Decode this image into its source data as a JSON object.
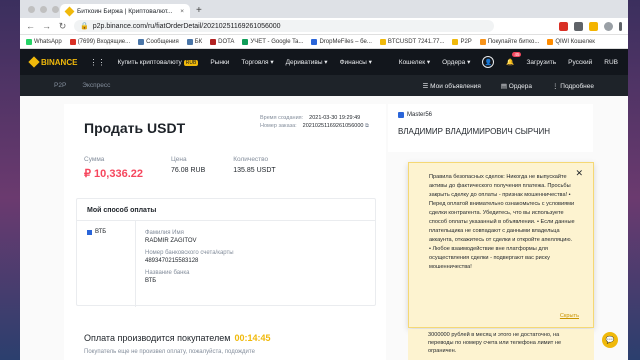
{
  "browser": {
    "tab_title": "Биткоин Биржа | Криптовалют...",
    "tab_close": "×",
    "new_tab": "+",
    "url": "p2p.binance.com/ru/fiatOrderDetail/20210251169261056000"
  },
  "bookmarks": [
    {
      "label": "WhatsApp",
      "color": "#25d366"
    },
    {
      "label": "(7699) Входящие...",
      "color": "#d93025"
    },
    {
      "label": "Сообщения",
      "color": "#4a76a8"
    },
    {
      "label": "БК",
      "color": "#4a76a8"
    },
    {
      "label": "DOTA",
      "color": "#b22222"
    },
    {
      "label": "УЧЕТ - Google Ta...",
      "color": "#0f9d58"
    },
    {
      "label": "DropMeFiles – бе...",
      "color": "#2a65d9"
    },
    {
      "label": "BTCUSDT 7241.77...",
      "color": "#f0b90b"
    },
    {
      "label": "P2P",
      "color": "#f0b90b"
    },
    {
      "label": "Покупайте битко...",
      "color": "#f7931a"
    },
    {
      "label": "QIWI Кошелек",
      "color": "#ff8c00"
    }
  ],
  "nav": {
    "logo": "BINANCE",
    "buy_crypto": "Купить криптовалюту",
    "buy_badge": "RUB",
    "markets": "Рынки",
    "trade": "Торговля ▾",
    "derivatives": "Деривативы ▾",
    "finance": "Финансы ▾",
    "wallet": "Кошелек ▾",
    "orders": "Ордера ▾",
    "notif_count": "45",
    "download": "Загрузить",
    "lang": "Русский",
    "currency": "RUB"
  },
  "p2p": {
    "tab_p2p": "P2P",
    "tab_express": "Экспресс",
    "my_ads": "Мои объявления",
    "orders": "Ордера",
    "more": "Подробнее"
  },
  "order": {
    "title": "Продать USDT",
    "created_label": "Время создания:",
    "created_value": "2021-03-30 19:29:49",
    "number_label": "Номер заказа:",
    "number_value": "20210251169261056000",
    "sum_label": "Сумма",
    "sum_value": "₽ 10,336.22",
    "price_label": "Цена",
    "price_value": "76.08 RUB",
    "qty_label": "Количество",
    "qty_value": "135.85 USDT",
    "payment_title": "Мой способ оплаты",
    "bank_tag": "ВТБ",
    "name_label": "Фамилия Имя",
    "name_value": "RADMIR ZAGITOV",
    "account_label": "Номер банковского счета/карты",
    "account_value": "4893470215583128",
    "bankname_label": "Название банка",
    "bankname_value": "ВТБ",
    "pay_by_buyer": "Оплата производится покупателем",
    "timer": "00:14:45",
    "pay_note": "Покупатель еще не произвел оплату, пожалуйста, подождите"
  },
  "seller": {
    "nick": "Master56",
    "name": "ВЛАДИМИР ВЛАДИМИРОВИЧ СЫРЧИН"
  },
  "tips": {
    "text": "Правила безопасных сделок: Никогда не выпускайте активы до фактического получения платежа. Просьбы закрыть сделку до оплаты - признак мошенничества! • Перед оплатой внимательно ознакомьтесь с условиями сделки контрагента. Убедитесь, что вы используете способ оплаты указанный в объявлении. • Если данные плательщика не совпадают с данными владельца аккаунта, откажитесь от сделки и откройте апелляцию. • Любое взаимодействие вне платформы для осуществления сделки - подвергают вас риску мошенничества!",
    "close": "✕",
    "more": "Скрыть",
    "extra": "3000000 рублей в месяц и этого не достаточно, на переводы по номеру счета или телефона лимит не ограничен."
  }
}
